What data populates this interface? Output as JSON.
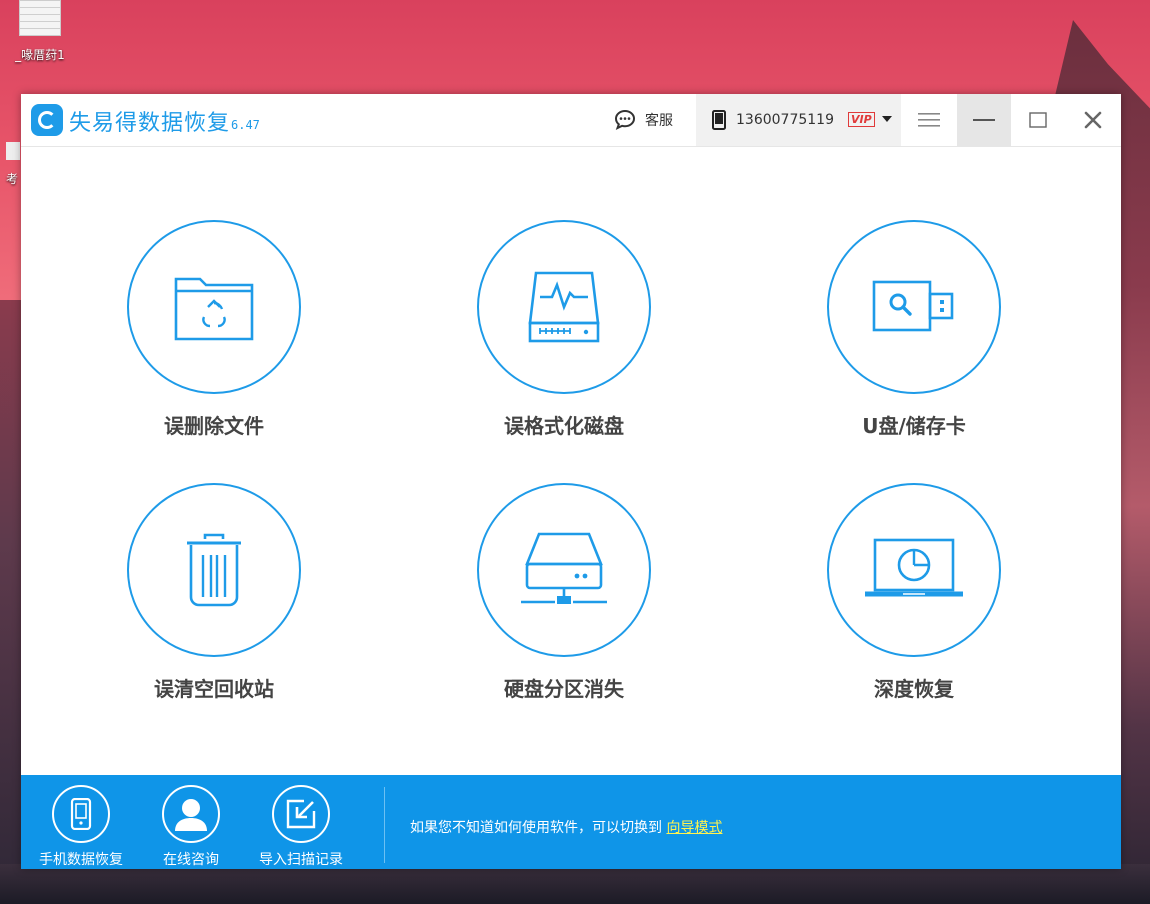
{
  "desktop": {
    "icon1_label": "_喙厝荮1",
    "icon2_label": "考"
  },
  "window": {
    "app_name": "失易得数据恢复",
    "version": "6.47",
    "support_label": "客服",
    "account_phone": "13600775119",
    "vip_label": "VIP"
  },
  "tiles": [
    {
      "label": "误删除文件",
      "icon": "folder-recycle-icon"
    },
    {
      "label": "误格式化磁盘",
      "icon": "disk-pulse-icon"
    },
    {
      "label": "U盘/储存卡",
      "icon": "usb-search-icon"
    },
    {
      "label": "误清空回收站",
      "icon": "trash-icon"
    },
    {
      "label": "硬盘分区消失",
      "icon": "network-drive-icon"
    },
    {
      "label": "深度恢复",
      "icon": "laptop-scan-icon"
    }
  ],
  "footer": {
    "items": [
      {
        "label": "手机数据恢复",
        "icon": "phone-icon"
      },
      {
        "label": "在线咨询",
        "icon": "person-icon"
      },
      {
        "label": "导入扫描记录",
        "icon": "import-icon"
      }
    ],
    "hint_text": "如果您不知道如何使用软件，可以切换到",
    "hint_link": "向导模式"
  },
  "colors": {
    "accent": "#1e9be8",
    "footer_bg": "#0f95e8",
    "link": "#fff34f",
    "vip": "#e03a3a"
  }
}
